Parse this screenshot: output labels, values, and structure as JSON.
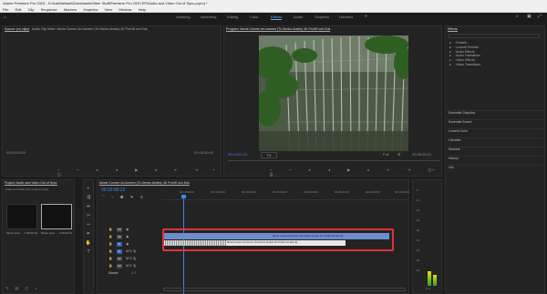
{
  "window": {
    "title": "Adobe Premiere Pro 2023 - D:\\Ads\\Netstat\\Downloads\\Other Stuff\\Premiere Pro 2020 EP\\Audio and Video Out of Sync.prproj *"
  },
  "menu": [
    "File",
    "Edit",
    "Clip",
    "Sequence",
    "Markers",
    "Graphics",
    "View",
    "Window",
    "Help"
  ],
  "workspaces": [
    "Learning",
    "Assembly",
    "Editing",
    "Color",
    "Effects",
    "Audio",
    "Graphics",
    "Libraries"
  ],
  "active_workspace": "Effects",
  "source_panel": {
    "tab": "Source: (no clips)",
    "tab2": "Audio Clip Mixer: Movie Comes Un-homem (To Dentro Andes) 4K ProHD w/o Eds",
    "timecode_left": "00:00:00:00",
    "timecode_right": "00:00:00:00"
  },
  "program_panel": {
    "tab": "Program: Movie Comes Un-homem (To Dentro Andes) 4K ProHD w/o Eds",
    "timecode_left": "00:13:00:22",
    "fit": "Fit",
    "quality": "Full",
    "timecode_right": "02:08:08:01"
  },
  "effects_panel": {
    "tab": "Effects",
    "items": [
      "Presets",
      "Lumetri Presets",
      "Audio Effects",
      "Audio Transitions",
      "Video Effects",
      "Video Transitions"
    ],
    "sections": [
      "Essential Graphics",
      "Essential Sound",
      "Lumetri Color",
      "Libraries",
      "Markers",
      "History",
      "Info"
    ]
  },
  "project_panel": {
    "tab": "Project: Audio and Video Out of Sync",
    "file": "Audio and Video Out of Sync.prproj",
    "items": [
      {
        "label": "Movie Com...",
        "dur": "1:46:04:22"
      },
      {
        "label": "Movie Com...",
        "dur": "1:46:04:21"
      }
    ]
  },
  "timeline": {
    "tab": "Movie Comes Un-homem (To Dentro Andes) 4K ProHD w/o Eds",
    "timecode": "00:15:00:22",
    "ruler": [
      "00:10:00:00",
      "00:15:00:00",
      "00:20:00:00",
      "00:25:00:00",
      "00:30:00:00",
      "00:35:00:00",
      "00:40:00:00",
      "00:45:00:00"
    ],
    "tracks": [
      "V3",
      "V2",
      "V1",
      "A1",
      "A2",
      "A3"
    ],
    "master": "Master",
    "master_val": "0.0",
    "clips": {
      "video": "Movie Comes Un-homem (To Dentro Andes) 4K ProHD w/o Eds [V]",
      "audio": "Movie Comes Un-homem (To Dentro Andes) 4K ProHD w/o Eds [A]"
    }
  },
  "meter": {
    "labels": [
      "-6",
      "-12",
      "-18",
      "-24",
      "-30",
      "-36",
      "-42",
      "-48",
      "-54"
    ]
  },
  "colors": {
    "accent": "#3d87f0",
    "highlight": "#e0323c",
    "video_clip": "#6b8ecf",
    "audio_clip": "#e8e8e8"
  }
}
